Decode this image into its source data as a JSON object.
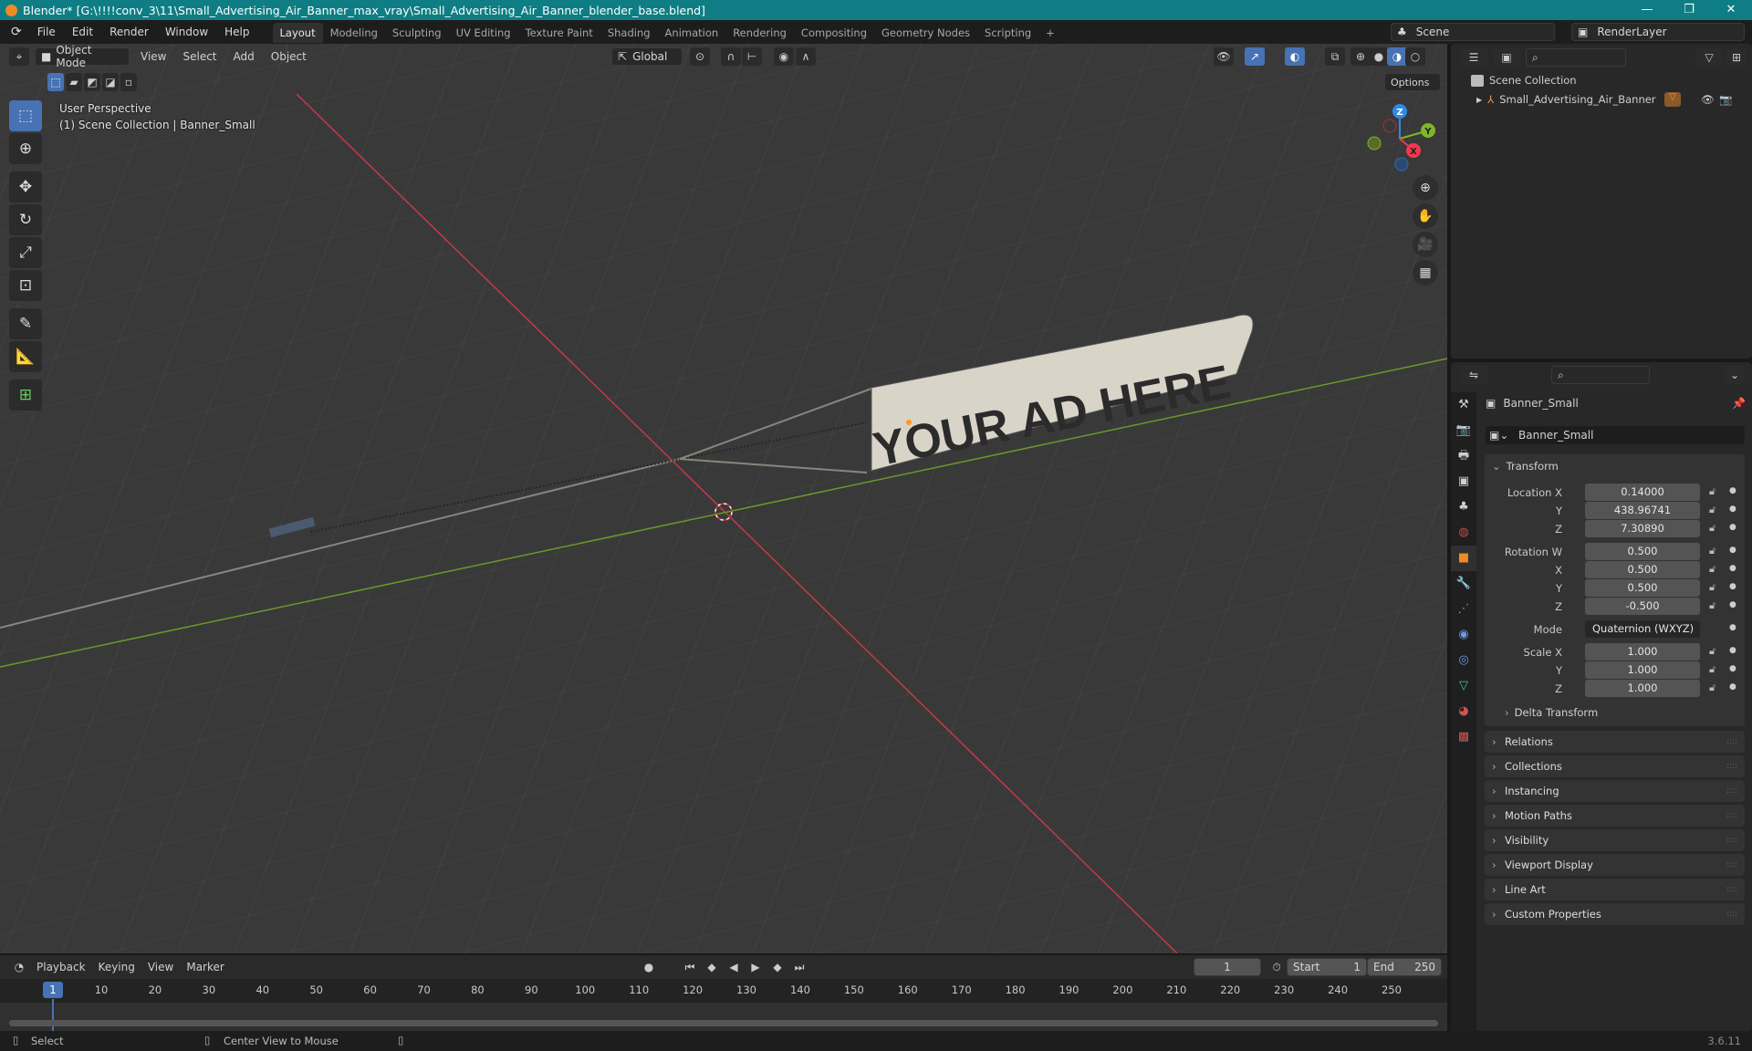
{
  "window": {
    "title": "Blender* [G:\\!!!!conv_3\\11\\Small_Advertising_Air_Banner_max_vray\\Small_Advertising_Air_Banner_blender_base.blend]",
    "controls": [
      "—",
      "❐",
      "✕"
    ]
  },
  "menu": [
    "File",
    "Edit",
    "Render",
    "Window",
    "Help"
  ],
  "workspaces": [
    "Layout",
    "Modeling",
    "Sculpting",
    "UV Editing",
    "Texture Paint",
    "Shading",
    "Animation",
    "Rendering",
    "Compositing",
    "Geometry Nodes",
    "Scripting",
    "+"
  ],
  "scene": {
    "name": "Scene",
    "view_layer": "RenderLayer"
  },
  "viewport": {
    "mode": "Object Mode",
    "menus": [
      "View",
      "Select",
      "Add",
      "Object"
    ],
    "orientation": "Global",
    "options": "Options",
    "overlay_line1": "User Perspective",
    "overlay_line2": "(1) Scene Collection | Banner_Small",
    "banner_text": "YOUR AD HERE",
    "gizmo": {
      "z": "Z",
      "y": "Y",
      "x": "X",
      "colors": {
        "x": "#f0384f",
        "y": "#7fb627",
        "z": "#2e8ae6"
      }
    }
  },
  "outliner": {
    "root": "Scene Collection",
    "items": [
      {
        "name": "Small_Advertising_Air_Banner"
      }
    ]
  },
  "properties": {
    "object_name": "Banner_Small",
    "data_name": "Banner_Small",
    "transform_label": "Transform",
    "location": {
      "label": "Location X",
      "x": "0.14000",
      "y": "438.96741",
      "z": "7.30890"
    },
    "rotation": {
      "label": "Rotation W",
      "w": "0.500",
      "x": "0.500",
      "y": "0.500",
      "z": "-0.500"
    },
    "mode": {
      "label": "Mode",
      "value": "Quaternion (WXYZ)"
    },
    "scale": {
      "label": "Scale X",
      "x": "1.000",
      "y": "1.000",
      "z": "1.000"
    },
    "axis": {
      "y": "Y",
      "z": "Z",
      "x": "X"
    },
    "delta": "Delta Transform",
    "sections": [
      "Relations",
      "Collections",
      "Instancing",
      "Motion Paths",
      "Visibility",
      "Viewport Display",
      "Line Art",
      "Custom Properties"
    ]
  },
  "timeline": {
    "menus": [
      "Playback",
      "Keying",
      "View",
      "Marker"
    ],
    "current_frame": "1",
    "start_label": "Start",
    "start": "1",
    "end_label": "End",
    "end": "250",
    "ticks": [
      "10",
      "20",
      "30",
      "40",
      "50",
      "60",
      "70",
      "80",
      "90",
      "100",
      "110",
      "120",
      "130",
      "140",
      "150",
      "160",
      "170",
      "180",
      "190",
      "200",
      "210",
      "220",
      "230",
      "240",
      "250"
    ]
  },
  "status": {
    "select": "Select",
    "center": "Center View to Mouse",
    "version": "3.6.11"
  }
}
